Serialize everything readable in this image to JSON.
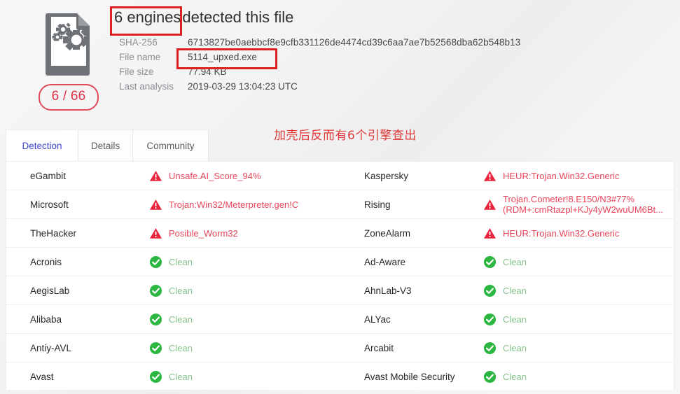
{
  "page": {
    "background_color": "#f2f2f2"
  },
  "summary": {
    "file_icon_label": "EXE",
    "ratio_badge": "6 / 66",
    "headline_count": "6 engines",
    "headline_rest": "detected this file",
    "meta": [
      {
        "label": "SHA-256",
        "value": "6713827be0aebbcf8e9cfb331126de4474cd39c6aa7ae7b52568dba62b548b13"
      },
      {
        "label": "File name",
        "value": "5114_upxed.exe"
      },
      {
        "label": "File size",
        "value": "77.94 KB"
      },
      {
        "label": "Last analysis",
        "value": "2019-03-29 13:04:23 UTC"
      }
    ]
  },
  "annotations": {
    "note_text": "加壳后反而有6个引擎查出",
    "note_color": "#e03a3a",
    "box_color": "#e02020",
    "boxed_targets": [
      "headline-engine-count",
      "file-name-value"
    ]
  },
  "tabs": [
    {
      "label": "Detection",
      "active": true
    },
    {
      "label": "Details",
      "active": false
    },
    {
      "label": "Community",
      "active": false
    }
  ],
  "detections": {
    "status_labels": {
      "clean": "Clean"
    },
    "colors": {
      "malicious": "#e8455a",
      "clean": "#86c38d",
      "accent": "#3d44d8"
    },
    "rows": [
      {
        "left": {
          "engine": "eGambit",
          "status": "malicious",
          "result": "Unsafe.AI_Score_94%"
        },
        "right": {
          "engine": "Kaspersky",
          "status": "malicious",
          "result": "HEUR:Trojan.Win32.Generic"
        }
      },
      {
        "left": {
          "engine": "Microsoft",
          "status": "malicious",
          "result": "Trojan:Win32/Meterpreter.gen!C"
        },
        "right": {
          "engine": "Rising",
          "status": "malicious",
          "result": "Trojan.Cometer!8.E150/N3#77%",
          "result_line2": "(RDM+:cmRtazpl+KJy4yW2wuUM6Bt..."
        }
      },
      {
        "left": {
          "engine": "TheHacker",
          "status": "malicious",
          "result": "Posible_Worm32"
        },
        "right": {
          "engine": "ZoneAlarm",
          "status": "malicious",
          "result": "HEUR:Trojan.Win32.Generic"
        }
      },
      {
        "left": {
          "engine": "Acronis",
          "status": "clean",
          "result": "Clean"
        },
        "right": {
          "engine": "Ad-Aware",
          "status": "clean",
          "result": "Clean"
        }
      },
      {
        "left": {
          "engine": "AegisLab",
          "status": "clean",
          "result": "Clean"
        },
        "right": {
          "engine": "AhnLab-V3",
          "status": "clean",
          "result": "Clean"
        }
      },
      {
        "left": {
          "engine": "Alibaba",
          "status": "clean",
          "result": "Clean"
        },
        "right": {
          "engine": "ALYac",
          "status": "clean",
          "result": "Clean"
        }
      },
      {
        "left": {
          "engine": "Antiy-AVL",
          "status": "clean",
          "result": "Clean"
        },
        "right": {
          "engine": "Arcabit",
          "status": "clean",
          "result": "Clean"
        }
      },
      {
        "left": {
          "engine": "Avast",
          "status": "clean",
          "result": "Clean"
        },
        "right": {
          "engine": "Avast Mobile Security",
          "status": "clean",
          "result": "Clean"
        }
      }
    ]
  }
}
